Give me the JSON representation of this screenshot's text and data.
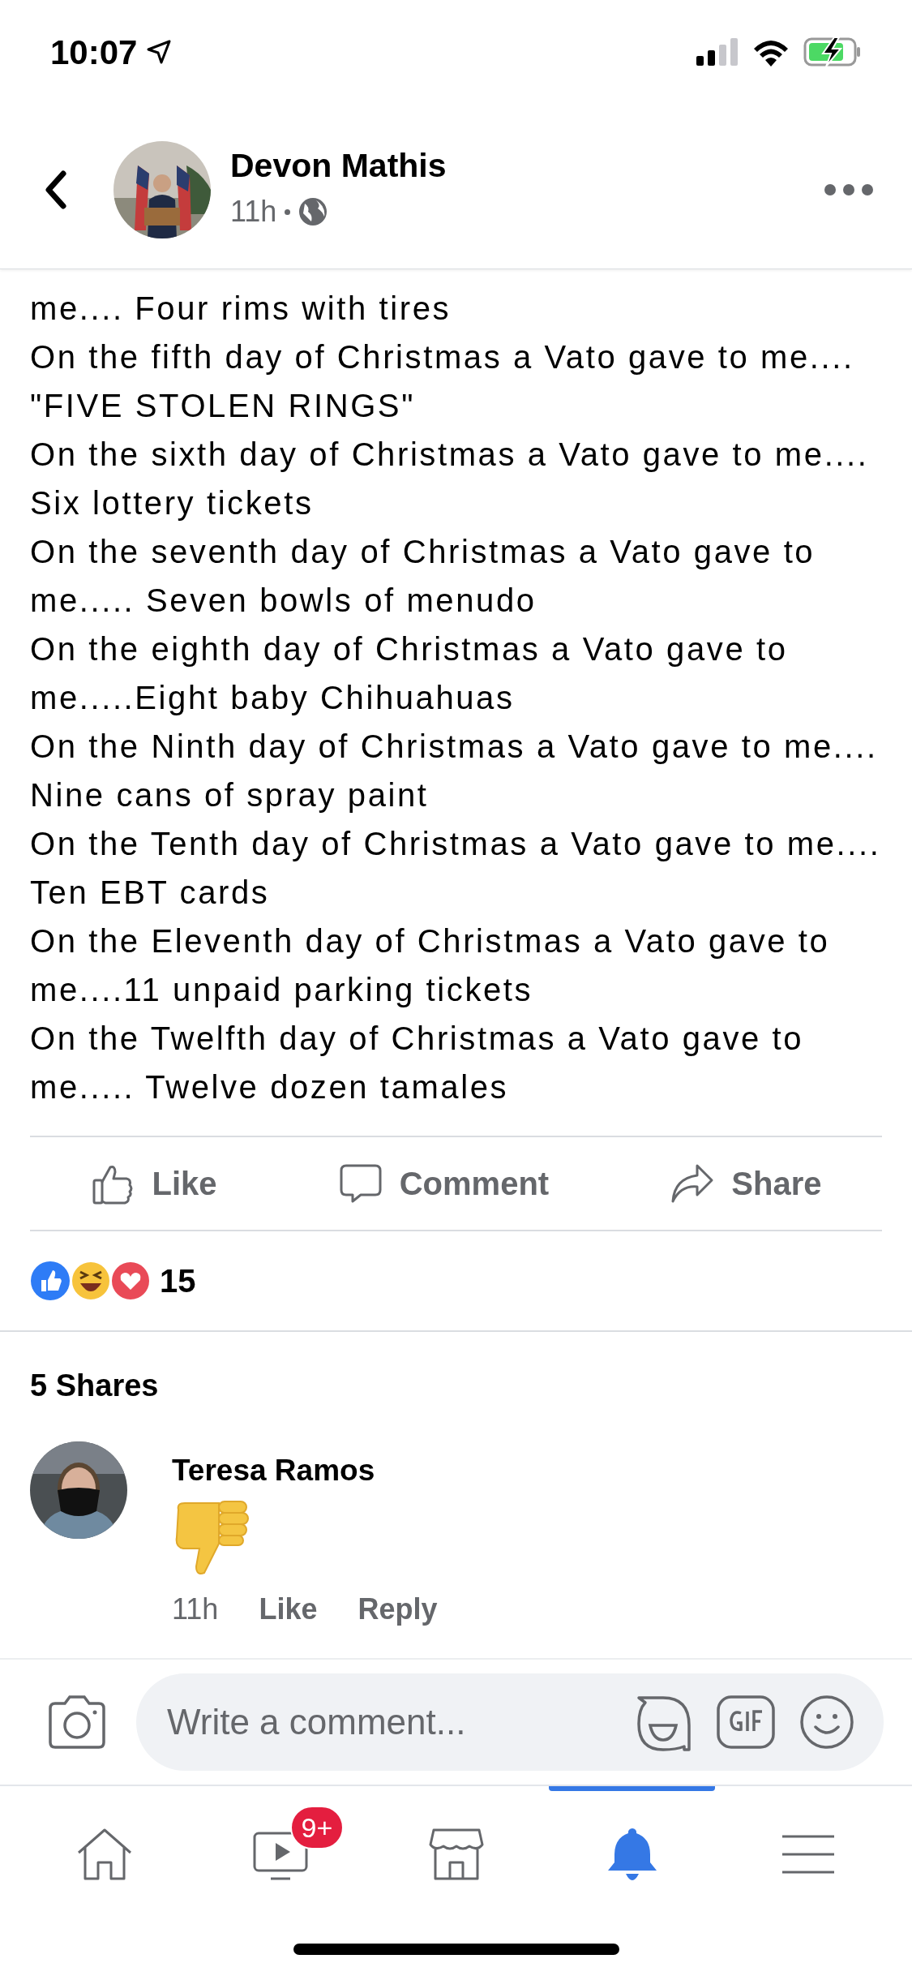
{
  "status_bar": {
    "time": "10:07"
  },
  "header": {
    "author": "Devon Mathis",
    "time": "11h"
  },
  "post": {
    "paragraphs": [
      "me.... Four rims with tires",
      "On the fifth day of Christmas a Vato gave to me.... \"FIVE STOLEN RINGS\"",
      "On the sixth day of Christmas a Vato gave to me.... Six lottery tickets",
      "On the seventh day of Christmas a Vato gave to me..... Seven bowls of menudo",
      "On the eighth day of Christmas a Vato gave to me.....Eight baby Chihuahuas",
      "On the Ninth day of Christmas a Vato gave to me.... Nine cans of spray paint",
      "On the Tenth day of Christmas a Vato gave to me.... Ten EBT cards",
      "On the Eleventh day of Christmas a Vato gave to me....11 unpaid parking tickets",
      "On the Twelfth day of Christmas a Vato gave to me..... Twelve dozen tamales"
    ]
  },
  "actions": [
    {
      "kind": "like",
      "label": "Like"
    },
    {
      "kind": "comment",
      "label": "Comment"
    },
    {
      "kind": "share",
      "label": "Share"
    }
  ],
  "reactions": {
    "count": "15"
  },
  "shares": "5 Shares",
  "comments": [
    {
      "author": "Teresa Ramos",
      "time": "11h",
      "actions": [
        "Like",
        "Reply"
      ]
    }
  ],
  "composer": {
    "placeholder": "Write a comment..."
  },
  "tab_bar": [
    {
      "kind": "home",
      "selected": false
    },
    {
      "kind": "video",
      "selected": false,
      "badge": "9+"
    },
    {
      "kind": "marketplace",
      "selected": false
    },
    {
      "kind": "notifications",
      "selected": true
    },
    {
      "kind": "menu",
      "selected": false
    }
  ]
}
